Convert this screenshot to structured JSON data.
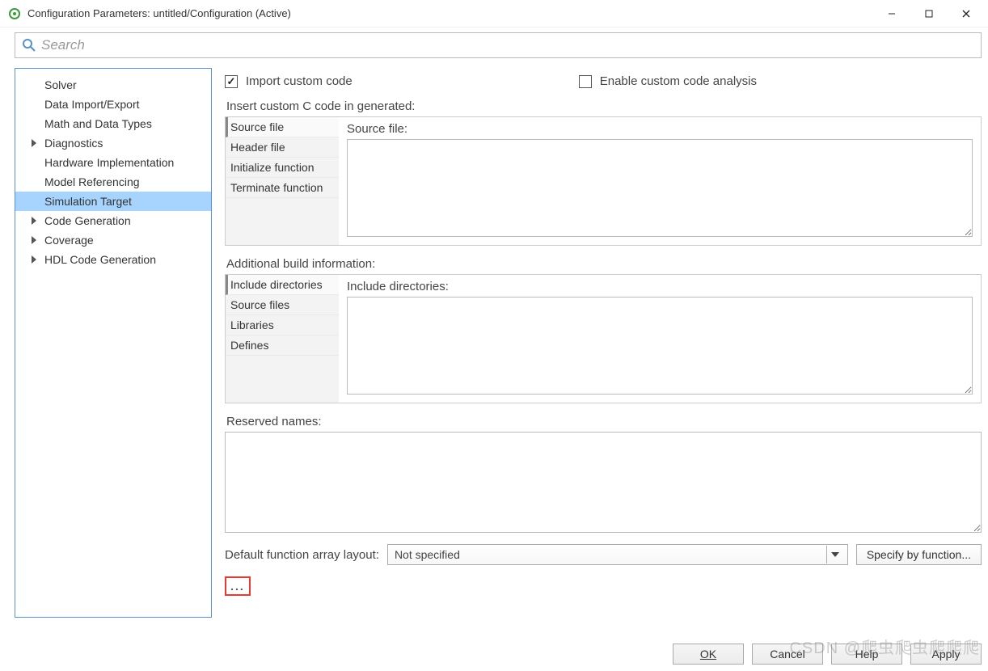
{
  "window": {
    "title": "Configuration Parameters: untitled/Configuration (Active)"
  },
  "search": {
    "placeholder": "Search"
  },
  "sidebar": {
    "items": [
      {
        "label": "Solver",
        "expandable": false
      },
      {
        "label": "Data Import/Export",
        "expandable": false
      },
      {
        "label": "Math and Data Types",
        "expandable": false
      },
      {
        "label": "Diagnostics",
        "expandable": true
      },
      {
        "label": "Hardware Implementation",
        "expandable": false
      },
      {
        "label": "Model Referencing",
        "expandable": false
      },
      {
        "label": "Simulation Target",
        "expandable": false,
        "selected": true
      },
      {
        "label": "Code Generation",
        "expandable": true
      },
      {
        "label": "Coverage",
        "expandable": true
      },
      {
        "label": "HDL Code Generation",
        "expandable": true
      }
    ]
  },
  "main": {
    "import_custom_code": {
      "label": "Import custom code",
      "checked": true
    },
    "enable_analysis": {
      "label": "Enable custom code analysis",
      "checked": false
    },
    "insert_section": {
      "title": "Insert custom C code in generated:",
      "tabs": [
        "Source file",
        "Header file",
        "Initialize function",
        "Terminate function"
      ],
      "active_tab": "Source file",
      "field_label": "Source file:",
      "value": ""
    },
    "build_section": {
      "title": "Additional build information:",
      "tabs": [
        "Include directories",
        "Source files",
        "Libraries",
        "Defines"
      ],
      "active_tab": "Include directories",
      "field_label": "Include directories:",
      "value": ""
    },
    "reserved": {
      "label": "Reserved names:",
      "value": ""
    },
    "layout": {
      "label": "Default function array layout:",
      "value": "Not specified",
      "spec_button": "Specify by function..."
    },
    "more_button": "..."
  },
  "footer": {
    "ok": "OK",
    "cancel": "Cancel",
    "help": "Help",
    "apply": "Apply"
  },
  "watermark": "CSDN @爬虫爬虫爬爬爬"
}
